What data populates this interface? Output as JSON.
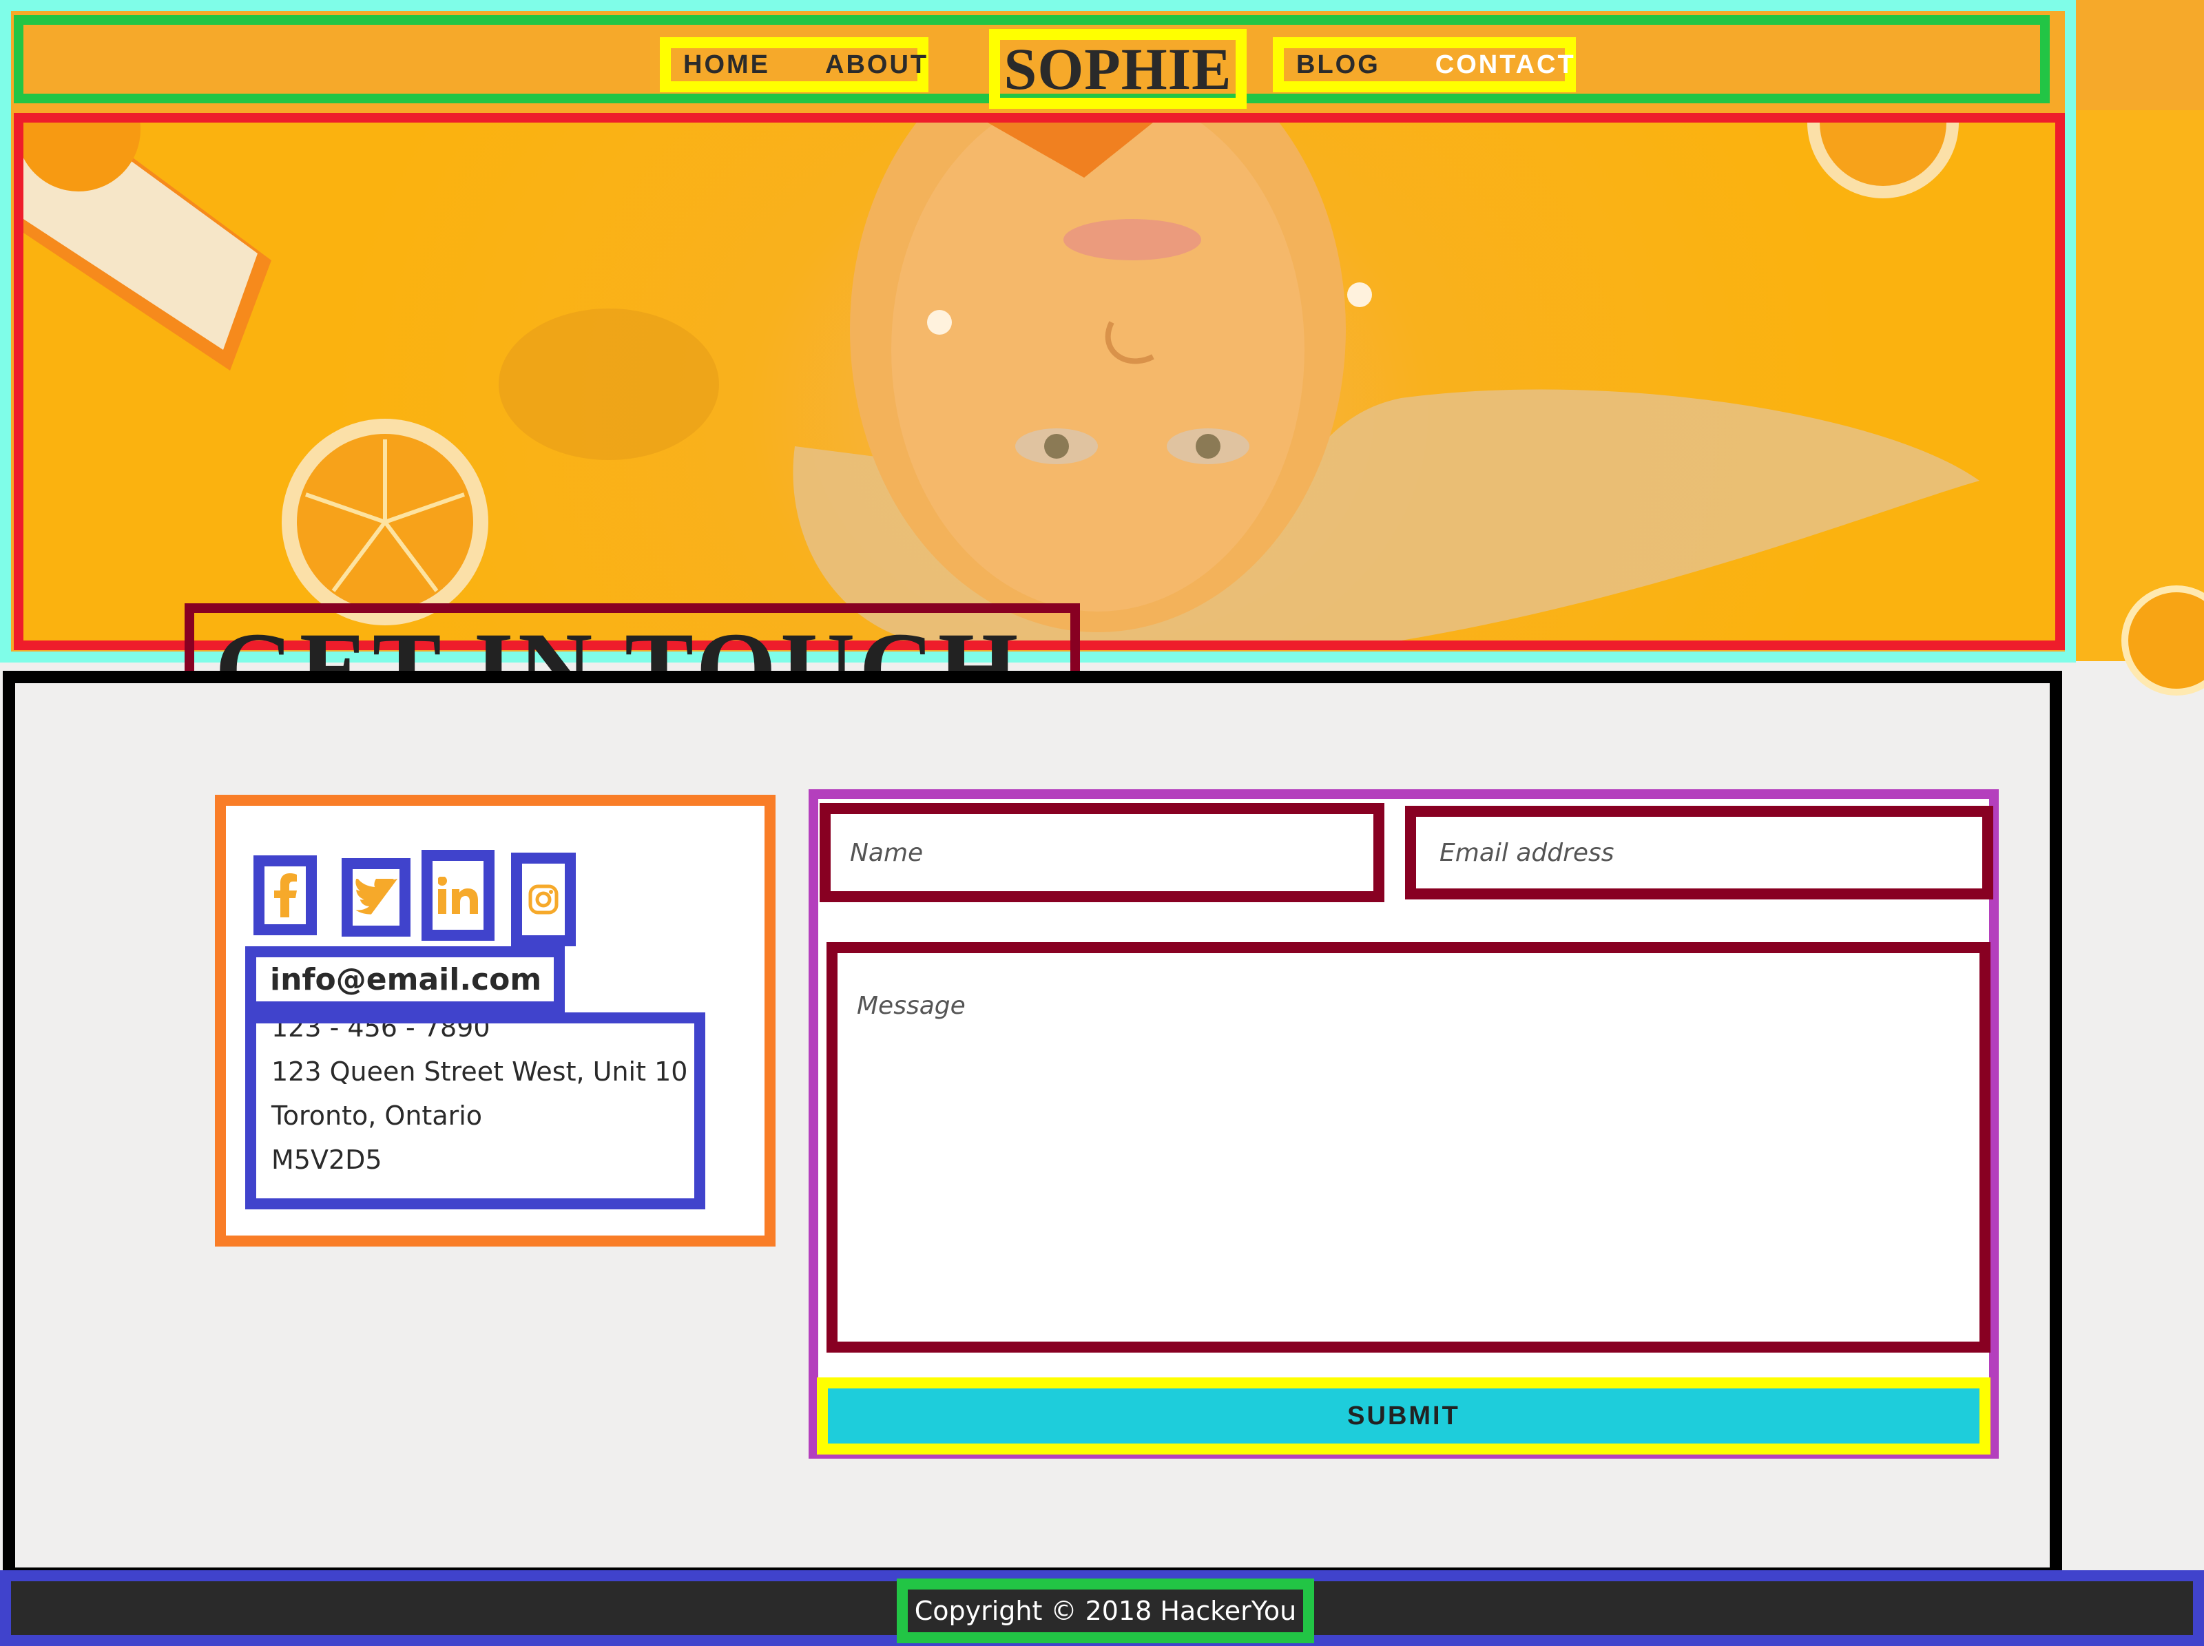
{
  "nav": {
    "left": [
      {
        "label": "HOME"
      },
      {
        "label": "ABOUT"
      }
    ],
    "brand": "SOPHIE",
    "right": [
      {
        "label": "BLOG"
      },
      {
        "label": "CONTACT"
      }
    ],
    "active": "CONTACT"
  },
  "hero": {
    "title": "GET IN TOUCH"
  },
  "contact_info": {
    "social": [
      {
        "icon": "facebook-icon"
      },
      {
        "icon": "twitter-icon"
      },
      {
        "icon": "linkedin-icon"
      },
      {
        "icon": "instagram-icon"
      }
    ],
    "email": "info@email.com",
    "phone": "123 - 456 - 7890",
    "address_line1": "123 Queen Street West, Unit 10",
    "address_line2": "Toronto, Ontario",
    "postal": "M5V2D5"
  },
  "form": {
    "name_placeholder": "Name",
    "email_placeholder": "Email address",
    "message_placeholder": "Message",
    "submit_label": "SUBMIT"
  },
  "footer": {
    "copyright": "Copyright © 2018 HackerYou"
  },
  "colors": {
    "accent_orange": "#f6a92a",
    "submit_cyan": "#1ecddb",
    "social_icon": "#f6a92a",
    "footer_bg": "#2a2a2a"
  }
}
